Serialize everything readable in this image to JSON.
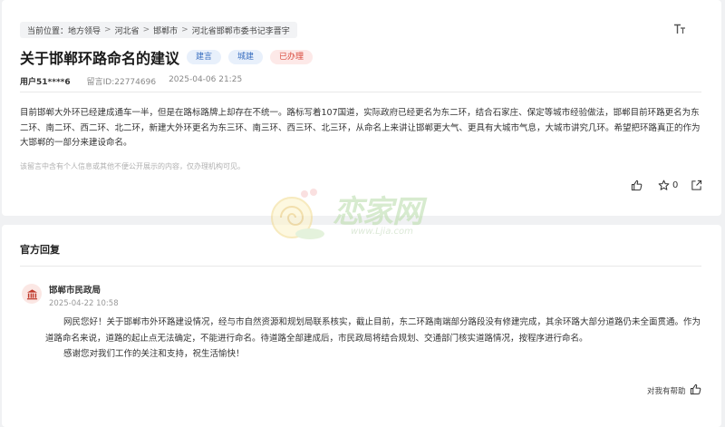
{
  "breadcrumb": {
    "prefix": "当前位置：",
    "items": [
      "地方领导",
      "河北省",
      "邯郸市",
      "河北省邯郸市委书记李晋宇"
    ],
    "separator": ">"
  },
  "font_toggle_icon": "font-size-icon",
  "post": {
    "title": "关于邯郸环路命名的建议",
    "tags": [
      {
        "label": "建言",
        "color": "#3a6fc0"
      },
      {
        "label": "城建",
        "color": "#3a6fc0"
      },
      {
        "label": "已办理",
        "color": "#d9483b"
      }
    ],
    "user": "用户51****6",
    "message_id": "留言ID:22774696",
    "datetime": "2025-04-06 21:25",
    "content": "目前邯郸大外环已经建成通车一半，但是在路标路牌上却存在不统一。路标写着107国道，实际政府已经更名为东二环，结合石家庄、保定等城市经验做法，邯郸目前环路更名为东二环、南二环、西二环、北二环，新建大外环更名为东三环、南三环、西三环、北三环，从命名上来讲让邯郸更大气、更具有大城市气息，大城市讲究几环。希望把环路真正的作为大邯郸的一部分来建设命名。",
    "privacy_note": "该留言中含有个人信息或其他不便公开展示的内容，仅办理机构可见。",
    "actions": {
      "like_icon": "thumbs-up-icon",
      "favorite_icon": "star-icon",
      "favorite_count": "0",
      "share_icon": "share-icon"
    }
  },
  "watermark": {
    "text": "恋家网",
    "sub": "www.Ljia.com"
  },
  "official_reply": {
    "section_title": "官方回复",
    "department": "邯郸市民政局",
    "date": "2025-04-22 10:58",
    "paragraph1": "网民您好！关于邯郸市外环路建设情况，经与市自然资源和规划局联系核实，截止目前，东二环路南端部分路段没有修建完成，其余环路大部分道路仍未全面贯通。作为道路命名来说，道路的起止点无法确定，不能进行命名。待道路全部建成后，市民政局将结合规划、交通部门核实道路情况，按程序进行命名。",
    "paragraph2": "感谢您对我们工作的关注和支持，祝生活愉快！",
    "helpful_label": "对我有帮助",
    "helpful_icon": "thumbs-up-icon"
  },
  "colors": {
    "tag_blue": "#3a6fc0",
    "tag_red": "#d9483b",
    "dept_icon": "#c0392b"
  }
}
